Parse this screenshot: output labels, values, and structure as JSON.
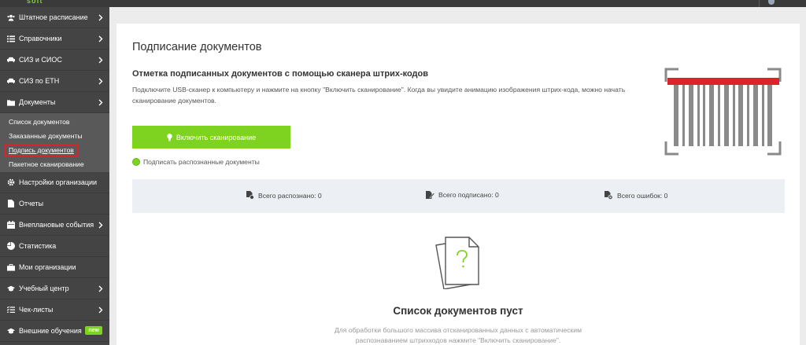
{
  "header": {
    "logo": "soft"
  },
  "sidebar": {
    "items": [
      {
        "label": "Штатное расписание"
      },
      {
        "label": "Справочники"
      },
      {
        "label": "СИЗ и СИОС"
      },
      {
        "label": "СИЗ по ЕТН"
      },
      {
        "label": "Документы"
      }
    ],
    "documents_sub": [
      {
        "label": "Список документов"
      },
      {
        "label": "Заказанные документы"
      },
      {
        "label": "Подпись документов"
      },
      {
        "label": "Пакетное сканирование"
      }
    ],
    "items2": [
      {
        "label": "Настройки организации"
      },
      {
        "label": "Отчеты"
      },
      {
        "label": "Внеплановые события"
      },
      {
        "label": "Статистика"
      },
      {
        "label": "Мои организации"
      },
      {
        "label": "Учебный центр"
      },
      {
        "label": "Чек-листы"
      },
      {
        "label": "Внешние обучения"
      }
    ],
    "new_badge": "new"
  },
  "main": {
    "title": "Подписание документов",
    "section_title": "Отметка подписанных документов с помощью сканера штрих-кодов",
    "description": "Подключите USB-сканер к компьютеру и нажмите на кнопку \"Включить сканирование\". Когда вы увидите анимацию изображения штрих-кода, можно начать сканирование документов.",
    "scan_button": "Включить сканирование",
    "checkbox_label": "Подписать распознанные документы",
    "stats": {
      "recognized": "Всего распознано: 0",
      "signed": "Всего подписано: 0",
      "errors": "Всего ошибок: 0"
    },
    "empty_title": "Список документов пуст",
    "empty_desc": "Для обработки большого массива отсканированных данных с автоматическим распознаванием штрихкодов нажмите \"Включить сканирование\"."
  },
  "colors": {
    "accent": "#7ed321",
    "sidebar": "#444444",
    "highlight": "#d9242c"
  }
}
